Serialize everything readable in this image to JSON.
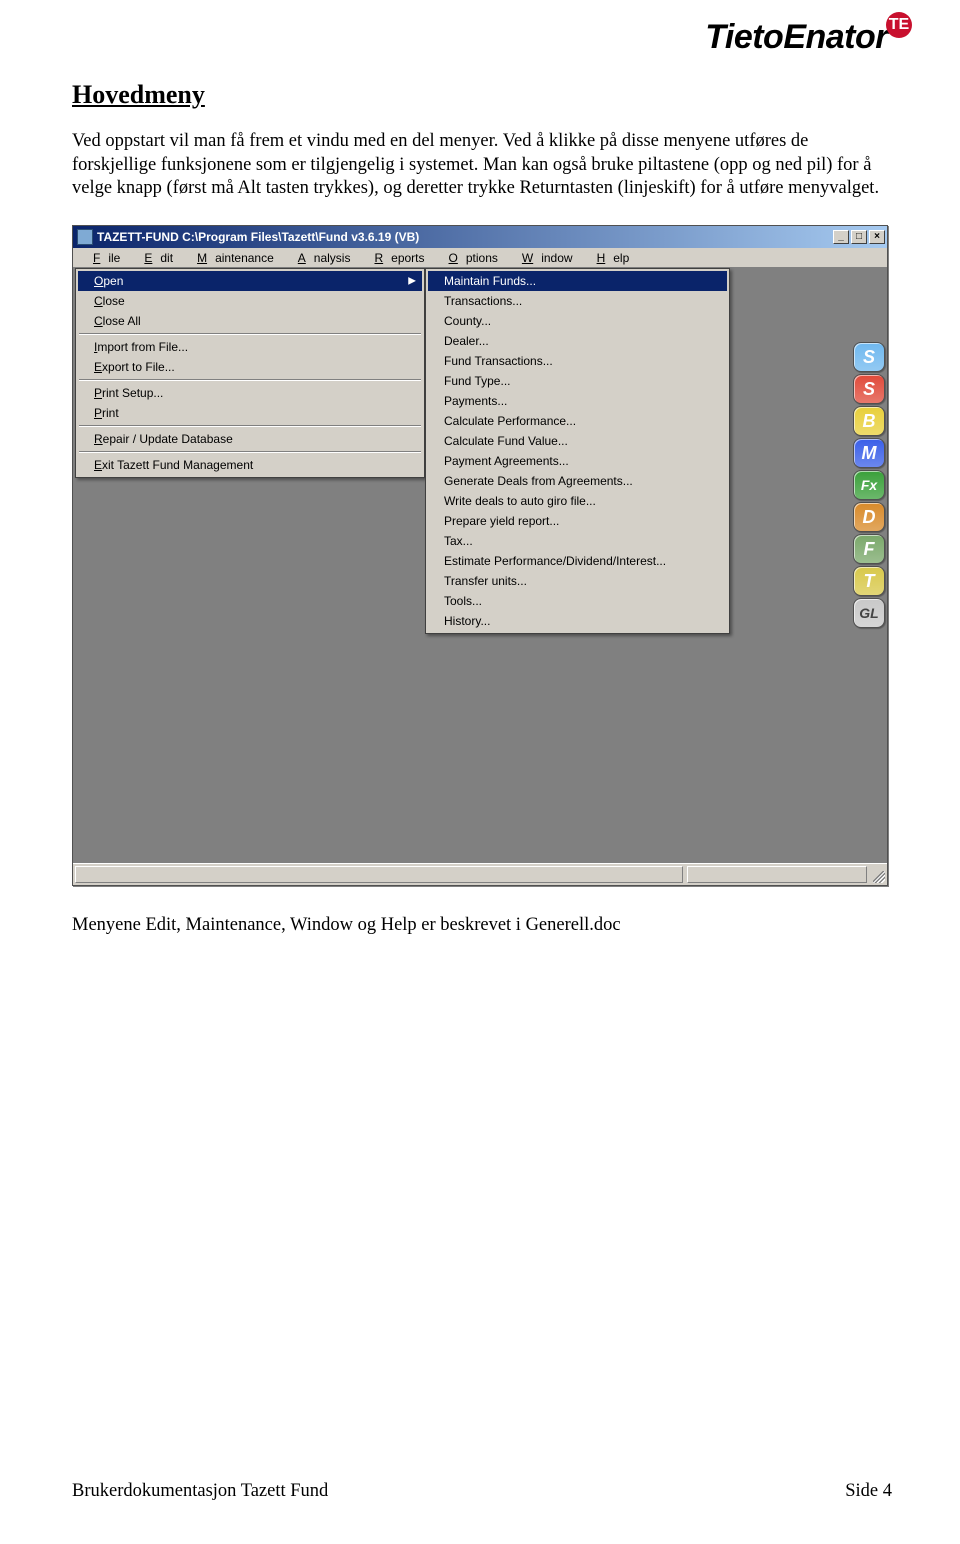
{
  "logo": {
    "text": "TietoEnator",
    "badge": "TE"
  },
  "heading": "Hovedmeny",
  "para1": "Ved oppstart vil man få frem et vindu med en del menyer. Ved å klikke på disse menyene utføres de forskjellige funksjonene som er tilgjengelig i systemet. Man kan også bruke piltastene (opp og ned pil) for å velge knapp (først må Alt tasten trykkes), og deretter trykke Returntasten (linjeskift) for å utføre menyvalget.",
  "window": {
    "title": "TAZETT-FUND  C:\\Program Files\\Tazett\\Fund  v3.6.19 (VB)",
    "menubar": [
      "File",
      "Edit",
      "Maintenance",
      "Analysis",
      "Reports",
      "Options",
      "Window",
      "Help"
    ],
    "fileMenu": [
      {
        "label": "Open",
        "type": "hi",
        "arrow": true
      },
      {
        "label": "Close"
      },
      {
        "label": "Close All"
      },
      {
        "type": "sep"
      },
      {
        "label": "Import from File..."
      },
      {
        "label": "Export to File..."
      },
      {
        "type": "sep"
      },
      {
        "label": "Print Setup..."
      },
      {
        "label": "Print"
      },
      {
        "type": "sep"
      },
      {
        "label": "Repair / Update Database"
      },
      {
        "type": "sep"
      },
      {
        "label": "Exit Tazett Fund Management"
      }
    ],
    "openSubmenu": [
      {
        "label": "Maintain Funds...",
        "type": "hi"
      },
      {
        "label": "Transactions..."
      },
      {
        "label": "County..."
      },
      {
        "label": "Dealer..."
      },
      {
        "label": "Fund Transactions..."
      },
      {
        "label": "Fund Type..."
      },
      {
        "label": "Payments..."
      },
      {
        "label": "Calculate Performance..."
      },
      {
        "label": "Calculate Fund Value..."
      },
      {
        "label": "Payment Agreements..."
      },
      {
        "label": "Generate Deals from Agreements..."
      },
      {
        "label": "Write deals to auto giro file..."
      },
      {
        "label": "Prepare yield report..."
      },
      {
        "label": "Tax..."
      },
      {
        "label": "Estimate Performance/Dividend/Interest..."
      },
      {
        "label": "Transfer units..."
      },
      {
        "label": "Tools..."
      },
      {
        "label": "History..."
      }
    ],
    "sideButtons": [
      {
        "t": "S",
        "bg": "#6fb8ef"
      },
      {
        "t": "S",
        "bg": "#e04a3a"
      },
      {
        "t": "B",
        "bg": "#e8cf3a"
      },
      {
        "t": "M",
        "bg": "#3a5fe8"
      },
      {
        "t": "Fx",
        "bg": "#3aa03a"
      },
      {
        "t": "D",
        "bg": "#d88a2a"
      },
      {
        "t": "F",
        "bg": "#7aa86a"
      },
      {
        "t": "T",
        "bg": "#d8c84a"
      },
      {
        "t": "GL",
        "bg": "#c8c8c8"
      }
    ]
  },
  "para2": "Menyene Edit, Maintenance, Window og Help er beskrevet i Generell.doc",
  "footer": {
    "left": "Brukerdokumentasjon Tazett Fund",
    "right": "Side 4"
  }
}
